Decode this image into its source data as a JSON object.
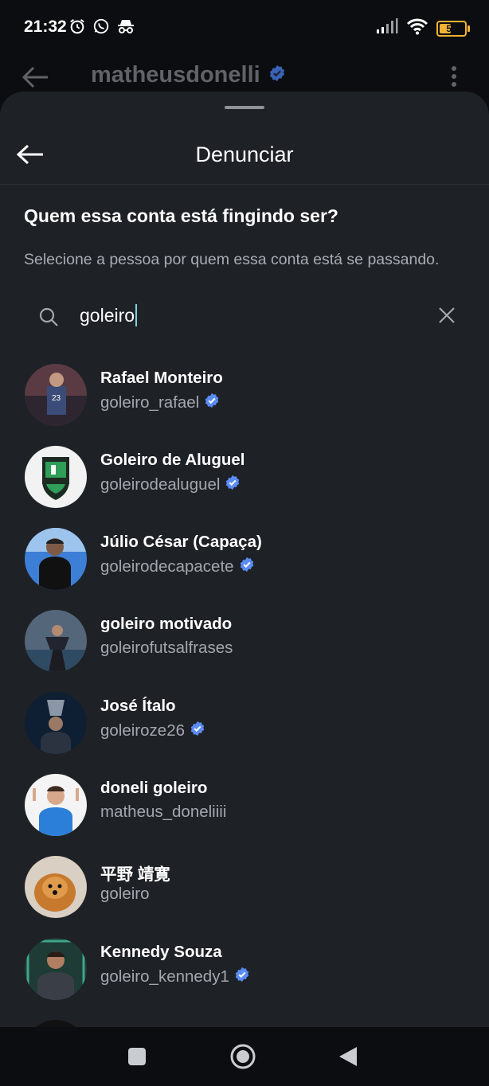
{
  "status": {
    "time": "21:32",
    "battery": "54",
    "battery_level": 0.54
  },
  "profile_header": {
    "username": "matheusdonelli",
    "verified": true
  },
  "sheet": {
    "title": "Denunciar",
    "question": "Quem essa conta está fingindo ser?",
    "subtitle": "Selecione a pessoa por quem essa conta está se passando."
  },
  "search": {
    "value": "goleiro"
  },
  "results": [
    {
      "name": "Rafael Monteiro",
      "handle": "goleiro_rafael",
      "verified": true
    },
    {
      "name": "Goleiro de Aluguel",
      "handle": "goleirodealuguel",
      "verified": true
    },
    {
      "name": "Júlio César (Capaça)",
      "handle": "goleirodecapacete",
      "verified": true
    },
    {
      "name": "goleiro motivado",
      "handle": "goleirofutsalfrases",
      "verified": false
    },
    {
      "name": "José Ítalo",
      "handle": "goleiroze26",
      "verified": true
    },
    {
      "name": "doneli goleiro",
      "handle": "matheus_doneliiii",
      "verified": false
    },
    {
      "name": "平野 靖寛",
      "handle": "goleiro",
      "verified": false
    },
    {
      "name": "Kennedy Souza",
      "handle": "goleiro_kennedy1",
      "verified": true
    }
  ],
  "colors": {
    "background": "#0b0d10",
    "sheet": "#1e2126",
    "verified": "#5b8cf5",
    "secondary_text": "#a3a8ae",
    "battery": "#f2b233"
  }
}
